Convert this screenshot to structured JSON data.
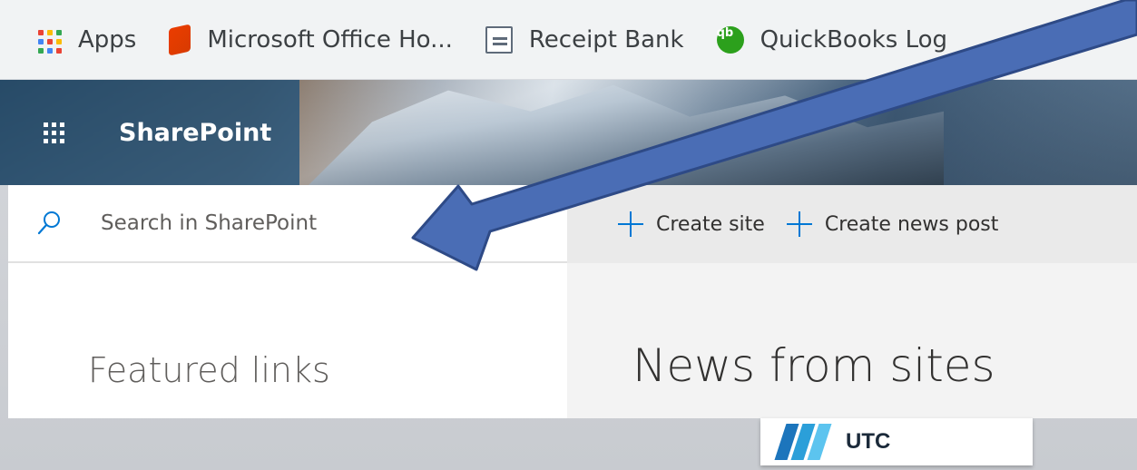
{
  "bookmarks": [
    {
      "label": "Apps",
      "icon": "apps-grid-icon"
    },
    {
      "label": "Microsoft Office Ho...",
      "icon": "office-icon"
    },
    {
      "label": "Receipt Bank",
      "icon": "receipt-bank-icon"
    },
    {
      "label": "QuickBooks Log",
      "icon": "quickbooks-icon",
      "icon_glyph": "qb"
    }
  ],
  "header": {
    "app_name": "SharePoint",
    "waffle_icon": "waffle-icon"
  },
  "search": {
    "placeholder": "Search in SharePoint",
    "icon": "search-icon"
  },
  "commands": [
    {
      "label": "Create site",
      "icon": "plus-icon"
    },
    {
      "label": "Create news post",
      "icon": "plus-icon"
    }
  ],
  "left_panel": {
    "title": "Featured links"
  },
  "main": {
    "title": "News from sites"
  },
  "logo": {
    "text": "UTC"
  },
  "colors": {
    "accent": "#0078d4",
    "brand_bar": "#1e5078",
    "arrow_fill": "#4a6db5",
    "arrow_stroke": "#2e4a86",
    "apps_grid": [
      "#ea4335",
      "#fbbc04",
      "#34a853",
      "#4285f4",
      "#ea4335",
      "#fbbc04",
      "#34a853",
      "#4285f4",
      "#ea4335"
    ],
    "utc_mark": [
      "#1c75bc",
      "#2b9fd9",
      "#5cc4ef"
    ]
  }
}
